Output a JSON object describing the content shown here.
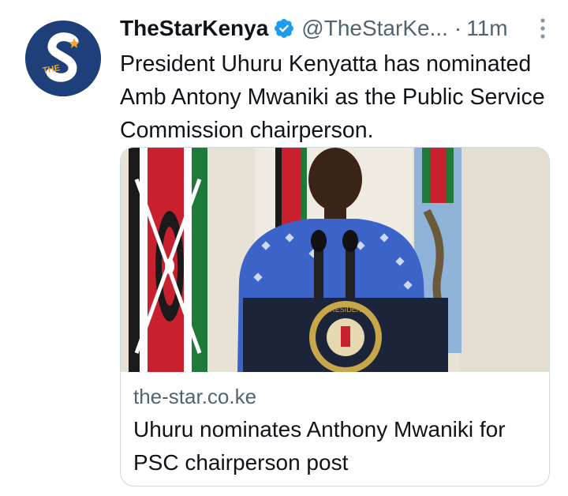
{
  "author": {
    "name": "TheStarKenya",
    "handle": "@TheStarKe...",
    "separator": "·",
    "time": "11m",
    "verified": true,
    "avatar_icon": "the-star-logo-icon",
    "avatar_logo_text": "THE"
  },
  "tweet": {
    "text": "President Uhuru Kenyatta has nominated Amb Antony Mwaniki as the Public Service Commission chairperson."
  },
  "card": {
    "domain": "the-star.co.ke",
    "title": "Uhuru nominates Anthony Mwaniki for PSC chairperson post",
    "image_icon": "press-briefing-photo",
    "podium_seal_text": "PRESIDENT"
  },
  "colors": {
    "brand_blue": "#1e3f7a",
    "verified_blue": "#1d9bf0",
    "secondary_text": "#536471",
    "border": "#cfd9de"
  }
}
